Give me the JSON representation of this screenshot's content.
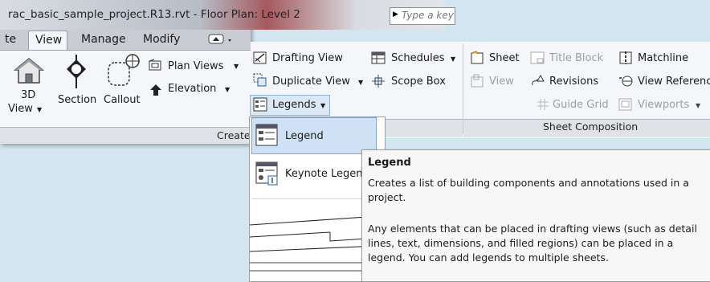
{
  "window": {
    "title": "rac_basic_sample_project.R13.rvt - Floor Plan: Level 2",
    "search_placeholder": "Type a key"
  },
  "tabs": [
    "te",
    "View",
    "Manage",
    "Modify"
  ],
  "create_panel": {
    "label": "Create",
    "buttons": {
      "view3d_line1": "3D",
      "view3d_line2": "View",
      "section": "Section",
      "callout": "Callout",
      "plan_views": "Plan Views",
      "elevation": "Elevation"
    }
  },
  "ribbon": {
    "drafting_view": "Drafting View",
    "duplicate_view": "Duplicate View",
    "legends": "Legends",
    "schedules": "Schedules",
    "scope_box": "Scope Box",
    "sheet": "Sheet",
    "view": "View",
    "title_block": "Title Block",
    "revisions": "Revisions",
    "guide_grid": "Guide Grid",
    "matchline": "Matchline",
    "view_reference": "View Referenc",
    "viewports": "Viewports"
  },
  "sheet_composition": {
    "label": "Sheet Composition"
  },
  "legends_menu": {
    "items": [
      "Legend",
      "Keynote Legen"
    ]
  },
  "tooltip": {
    "title": "Legend",
    "description": "Creates a list of building components and annotations used in a project.",
    "more": "Any elements that can be placed in drafting views (such as detail lines, text, dimensions, and filled regions) can be placed in a legend. You can add legends to multiple sheets."
  },
  "colors": {
    "background": "#d3e5ee",
    "highlight": "#cfe2f5",
    "ribbon": "#f4f6f9"
  }
}
